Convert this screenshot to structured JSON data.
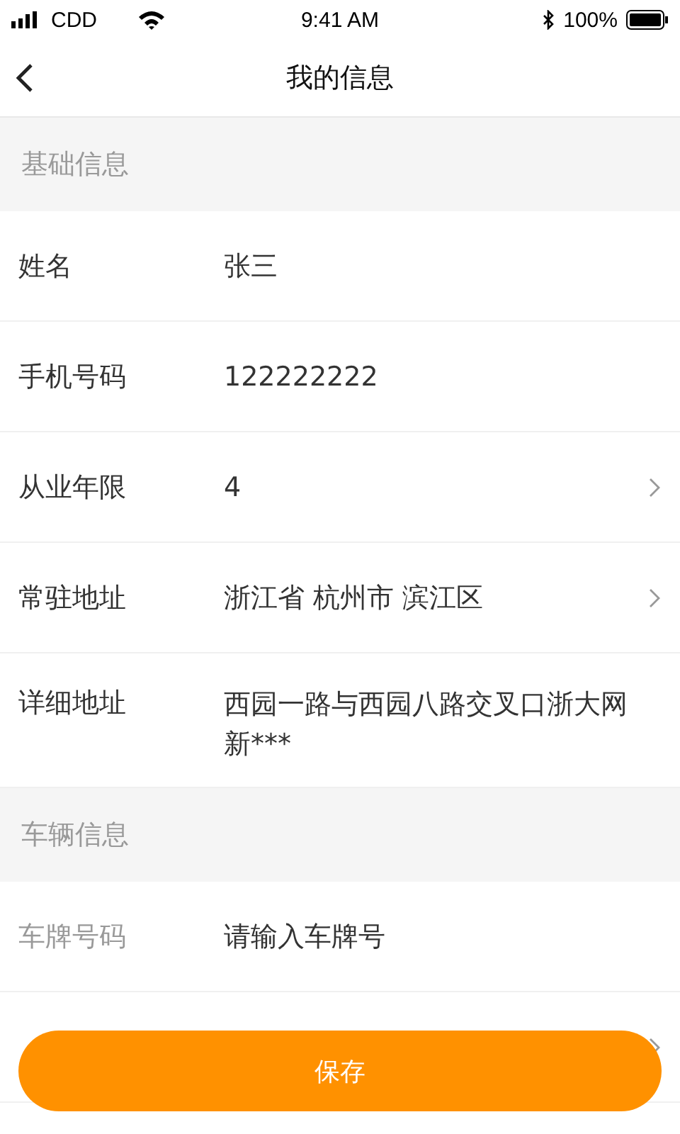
{
  "status_bar": {
    "carrier": "CDD",
    "time": "9:41 AM",
    "battery": "100%"
  },
  "nav": {
    "title": "我的信息"
  },
  "sections": [
    {
      "title": "基础信息",
      "rows": [
        {
          "label": "姓名",
          "value": "张三",
          "chevron": false,
          "muted_label": false
        },
        {
          "label": "手机号码",
          "value": "122222222",
          "chevron": false,
          "muted_label": false
        },
        {
          "label": "从业年限",
          "value": "4",
          "chevron": true,
          "muted_label": false
        },
        {
          "label": "常驻地址",
          "value": "浙江省 杭州市 滨江区",
          "chevron": true,
          "muted_label": false
        },
        {
          "label": "详细地址",
          "value": "西园一路与西园八路交叉口浙大网新***",
          "chevron": false,
          "muted_label": false
        }
      ]
    },
    {
      "title": "车辆信息",
      "rows": [
        {
          "label": "车牌号码",
          "value": "请输入车牌号",
          "chevron": false,
          "muted_label": true
        },
        {
          "chevron": true
        }
      ]
    }
  ],
  "save_button": "保存"
}
